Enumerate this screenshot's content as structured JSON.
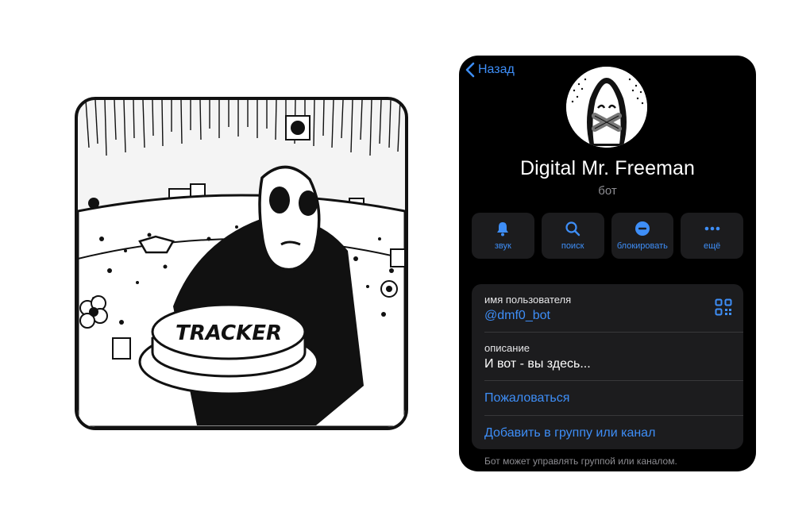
{
  "header": {
    "back_label": "Назад"
  },
  "profile": {
    "name": "Digital Mr. Freeman",
    "subtitle": "бот"
  },
  "actions": [
    {
      "label": "звук",
      "icon": "bell-icon"
    },
    {
      "label": "поиск",
      "icon": "search-icon"
    },
    {
      "label": "блокировать",
      "icon": "block-icon"
    },
    {
      "label": "ещё",
      "icon": "more-icon"
    }
  ],
  "info": {
    "username_title": "имя пользователя",
    "username_value": "@dmf0_bot",
    "description_title": "описание",
    "description_value": "И вот - вы здесь...",
    "report_label": "Пожаловаться",
    "add_label": "Добавить в группу или канал",
    "footer_note": "Бот может управлять группой или каналом."
  },
  "comic": {
    "button_text": "TRACKER"
  },
  "colors": {
    "accent": "#3e8ef7",
    "background": "#000000",
    "card": "#1c1c1e",
    "secondary_text": "#8d8d92"
  }
}
